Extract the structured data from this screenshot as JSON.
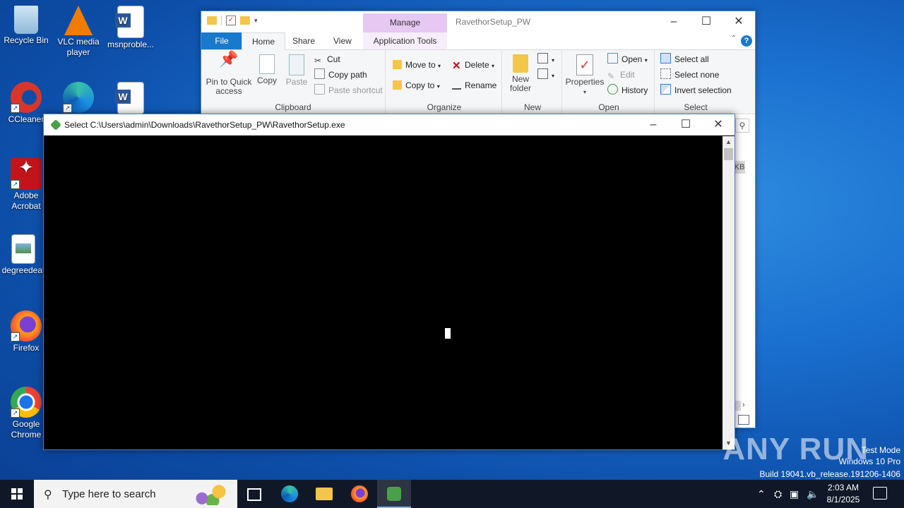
{
  "desktop": {
    "icons": [
      {
        "label": "Recycle Bin"
      },
      {
        "label": "VLC media player"
      },
      {
        "label": "msnproble..."
      },
      {
        "label": "CCleaner"
      },
      {
        "label": ""
      },
      {
        "label": ""
      },
      {
        "label": "Adobe Acrobat"
      },
      {
        "label": "degreedeat"
      },
      {
        "label": "Firefox"
      },
      {
        "label": "Google Chrome"
      }
    ]
  },
  "explorer": {
    "title": "RavethorSetup_PW",
    "contextual_tab": "Manage",
    "tabs": {
      "file": "File",
      "home": "Home",
      "share": "Share",
      "view": "View",
      "app_tools": "Application Tools"
    },
    "clipboard": {
      "pin": "Pin to Quick access",
      "copy": "Copy",
      "paste": "Paste",
      "cut": "Cut",
      "copy_path": "Copy path",
      "paste_shortcut": "Paste shortcut",
      "label": "Clipboard"
    },
    "organize": {
      "move_to": "Move to",
      "copy_to": "Copy to",
      "delete": "Delete",
      "rename": "Rename",
      "label": "Organize"
    },
    "new": {
      "new_folder": "New folder",
      "label": "New"
    },
    "open": {
      "properties": "Properties",
      "open": "Open",
      "edit": "Edit",
      "history": "History",
      "label": "Open"
    },
    "select": {
      "select_all": "Select all",
      "select_none": "Select none",
      "invert": "Invert selection",
      "label": "Select"
    },
    "size_fragment": "KB",
    "help": "?"
  },
  "console": {
    "title": "Select C:\\Users\\admin\\Downloads\\RavethorSetup_PW\\RavethorSetup.exe"
  },
  "watermark": {
    "brand": "ANY RUN",
    "line1": "Test Mode",
    "line2": "Windows 10 Pro",
    "line3": "Build 19041.vb_release.191206-1406"
  },
  "taskbar": {
    "search_placeholder": "Type here to search",
    "time": "2:03 AM",
    "date": "8/1/2025"
  },
  "colors": {
    "accent": "#1979ca",
    "manage_tab": "#e6c8f2",
    "taskbar": "#101828"
  }
}
